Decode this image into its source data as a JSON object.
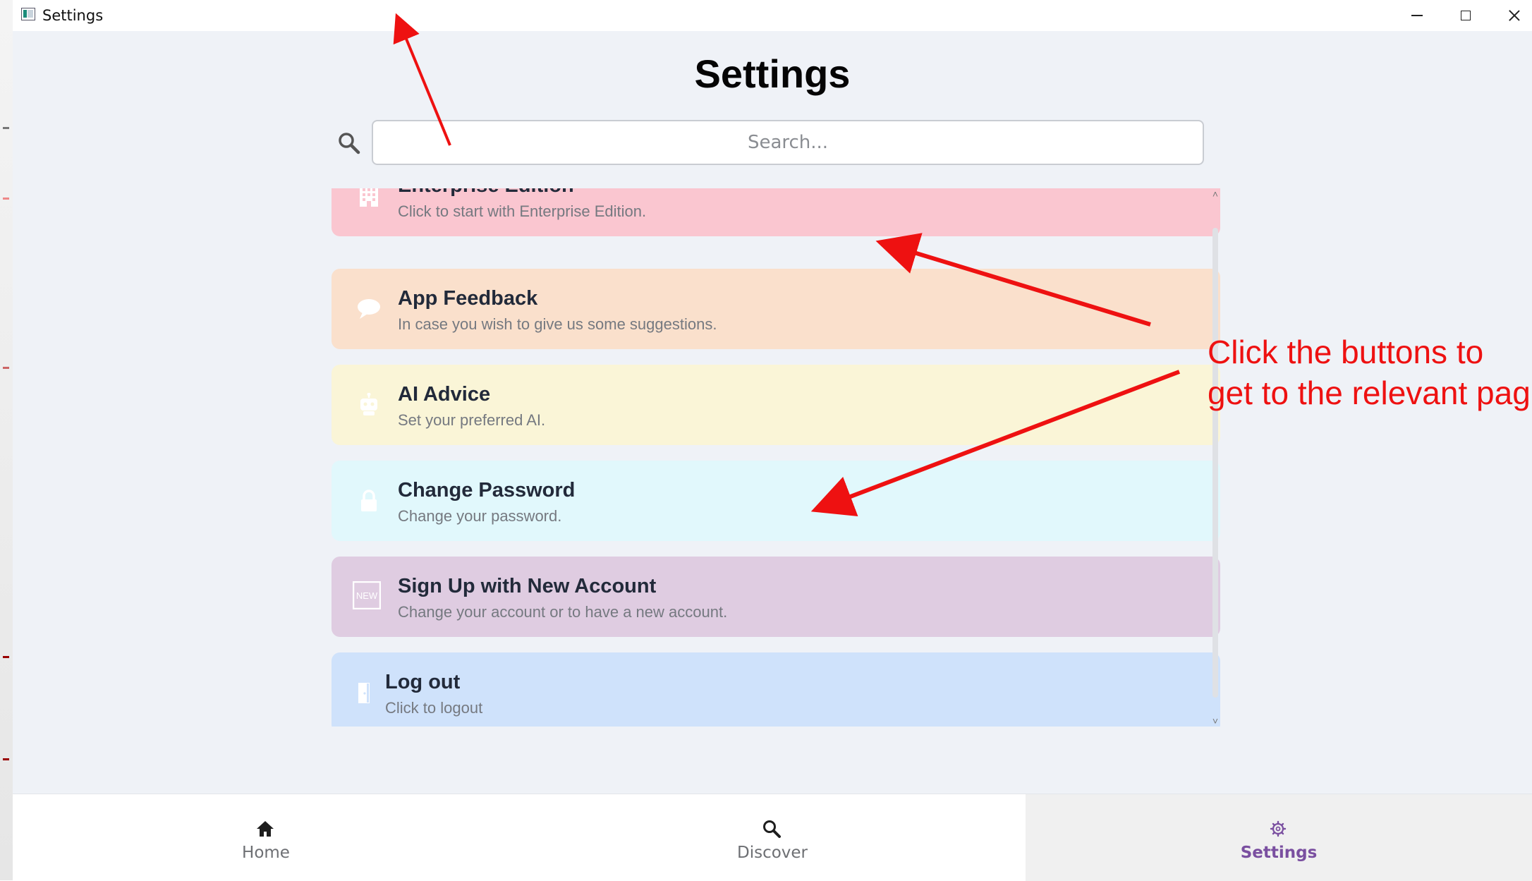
{
  "window": {
    "title": "Settings",
    "controls": [
      "minimize",
      "maximize",
      "close"
    ]
  },
  "page": {
    "title": "Settings"
  },
  "search": {
    "placeholder": "Search...",
    "value": "",
    "icon": "search-icon"
  },
  "items": [
    {
      "id": "enterprise",
      "title": "Enterprise Edition",
      "subtitle": "Click to start with Enterprise Edition.",
      "icon": "building-icon",
      "color": "#fac6d0"
    },
    {
      "id": "feedback",
      "title": "App Feedback",
      "subtitle": "In case you wish to give us some suggestions.",
      "icon": "chat-bubble-icon",
      "color": "#fae0cc"
    },
    {
      "id": "ai-advice",
      "title": "AI Advice",
      "subtitle": "Set your preferred AI.",
      "icon": "robot-icon",
      "color": "#faf5d7"
    },
    {
      "id": "change-password",
      "title": "Change Password",
      "subtitle": "Change your password.",
      "icon": "lock-icon",
      "color": "#e1f8fc"
    },
    {
      "id": "signup",
      "title": "Sign Up with New Account",
      "subtitle": "Change your account or to have a new account.",
      "icon": "new-badge-icon",
      "icon_text": "NEW",
      "color": "#dfcce1"
    },
    {
      "id": "logout",
      "title": "Log out",
      "subtitle": "Click to logout",
      "icon": "door-icon",
      "color": "#cfe2fb"
    }
  ],
  "annotation": {
    "text_line1": "Click the buttons to",
    "text_line2": "get to the relevant pag",
    "color": "#ee1111"
  },
  "bottom_nav": {
    "items": [
      {
        "label": "Home",
        "icon": "home-icon"
      },
      {
        "label": "Discover",
        "icon": "search-icon"
      },
      {
        "label": "Settings",
        "icon": "gear-icon",
        "active": true
      }
    ],
    "active_color": "#7a4fa0"
  }
}
